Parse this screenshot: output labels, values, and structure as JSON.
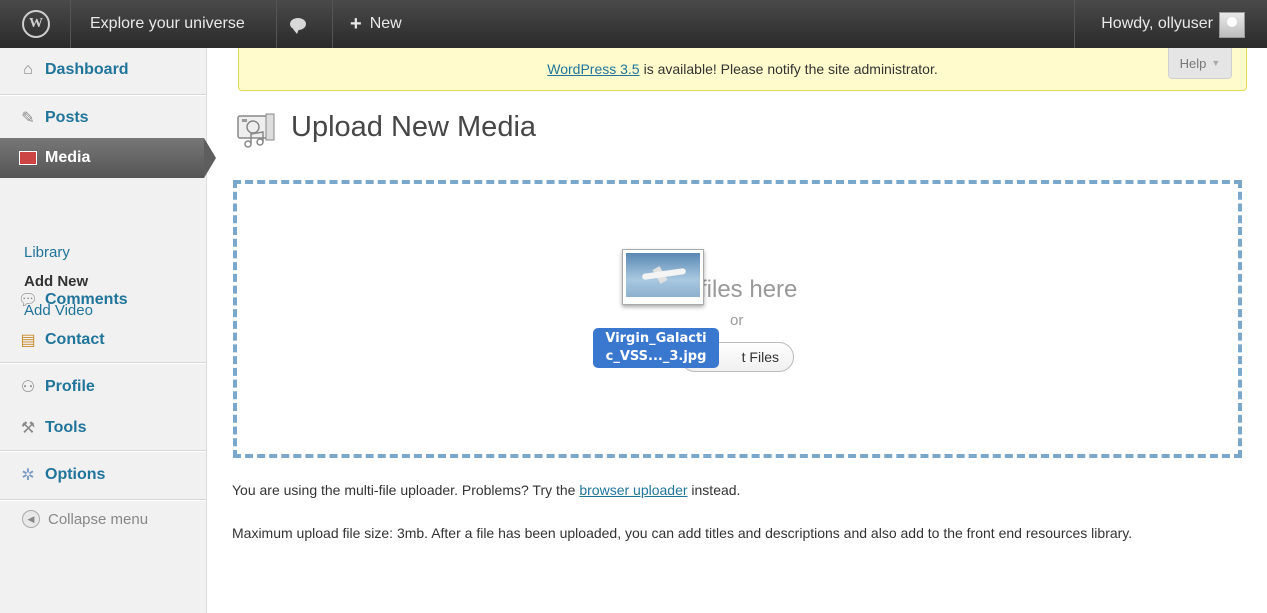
{
  "adminbar": {
    "site_name": "Explore your universe",
    "new_label": "New",
    "howdy": "Howdy, ollyuser"
  },
  "sidebar": {
    "items": [
      {
        "label": "Dashboard",
        "icon": "home-icon"
      },
      {
        "label": "Posts",
        "icon": "pin-icon"
      },
      {
        "label": "Media",
        "icon": "media-icon",
        "current": true
      },
      {
        "label": "Comments",
        "icon": "comment-icon"
      },
      {
        "label": "Contact",
        "icon": "contact-icon"
      },
      {
        "label": "Profile",
        "icon": "users-icon"
      },
      {
        "label": "Tools",
        "icon": "tools-icon"
      },
      {
        "label": "Options",
        "icon": "options-icon"
      }
    ],
    "submenu": [
      "Library",
      "Add New",
      "Add Video"
    ],
    "collapse": "Collapse menu"
  },
  "notice": {
    "link": "WordPress 3.5",
    "text": "is available! Please notify the site administrator.",
    "help": "Help"
  },
  "main": {
    "title": "Upload New Media",
    "drop_text": "files here",
    "or": "or",
    "select_btn": "t Files",
    "drag_file_line1": "Virgin_Galacti",
    "drag_file_line2": "c_VSS..._3.jpg",
    "info1_pre": "You are using the multi-file uploader. Problems? Try the",
    "info1_link": "browser uploader",
    "info1_post": "instead.",
    "info2": "Maximum upload file size: 3mb. After a file has been uploaded, you can add titles and descriptions and also add to the front end resources library."
  },
  "colors": {
    "accent_link": "#21759b",
    "notice_bg": "#fffbcc",
    "drop_border": "#7aa8cc",
    "drag_label": "#3a78d0"
  }
}
